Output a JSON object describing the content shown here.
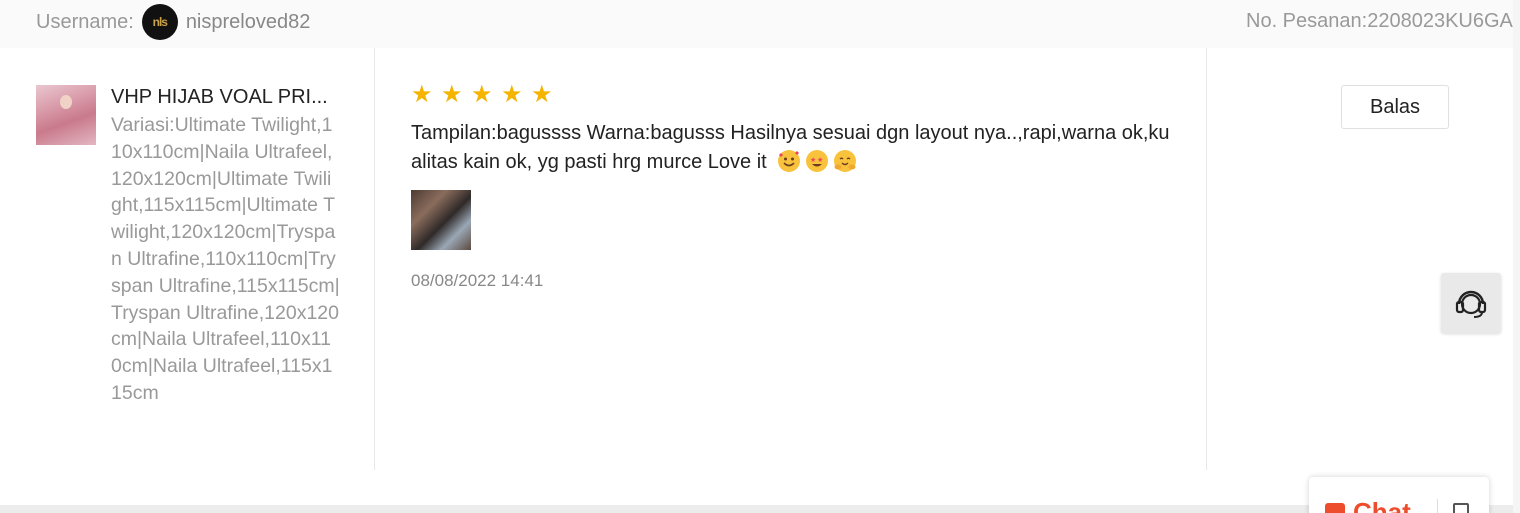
{
  "header": {
    "username_label": "Username:",
    "username": "nispreloved82",
    "avatar_text": "nls",
    "order_label": "No. Pesanan:",
    "order_number": "2208023KU6GA"
  },
  "product": {
    "name": "VHP HIJAB VOAL PRI...",
    "variation": "Variasi:Ultimate Twilight,110x110cm|Naila Ultrafeel,120x120cm|Ultimate Twilight,115x115cm|Ultimate Twilight,120x120cm|Tryspan Ultrafine,110x110cm|Tryspan Ultrafine,115x115cm|Tryspan Ultrafine,120x120cm|Naila Ultrafeel,110x110cm|Naila Ultrafeel,115x115cm"
  },
  "review": {
    "rating": 5,
    "rating_max": 5,
    "star_color": "#f5b400",
    "text": "Tampilan:bagussss Warna:bagusss Hasilnya sesuai dgn layout nya..,rapi,warna ok,kualitas kain ok, yg pasti hrg murce Love it",
    "emojis": [
      "smiling-face-with-hearts",
      "star-struck",
      "hugging-face"
    ],
    "date": "08/08/2022 14:41"
  },
  "actions": {
    "reply_label": "Balas"
  },
  "chat": {
    "label": "Chat",
    "accent_color": "#ee4d2d"
  },
  "icons": {
    "support": "headset-icon",
    "chat": "chat-icon"
  }
}
